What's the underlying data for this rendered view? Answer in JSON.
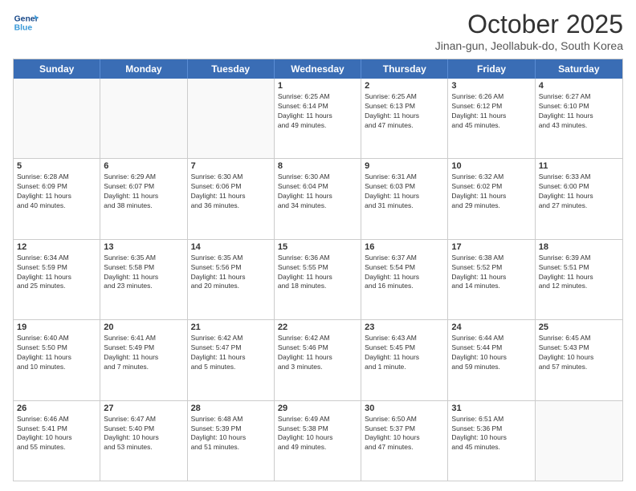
{
  "logo": {
    "line1": "General",
    "line2": "Blue"
  },
  "title": "October 2025",
  "subtitle": "Jinan-gun, Jeollabuk-do, South Korea",
  "days_of_week": [
    "Sunday",
    "Monday",
    "Tuesday",
    "Wednesday",
    "Thursday",
    "Friday",
    "Saturday"
  ],
  "weeks": [
    [
      {
        "day": "",
        "info": ""
      },
      {
        "day": "",
        "info": ""
      },
      {
        "day": "",
        "info": ""
      },
      {
        "day": "1",
        "info": "Sunrise: 6:25 AM\nSunset: 6:14 PM\nDaylight: 11 hours\nand 49 minutes."
      },
      {
        "day": "2",
        "info": "Sunrise: 6:25 AM\nSunset: 6:13 PM\nDaylight: 11 hours\nand 47 minutes."
      },
      {
        "day": "3",
        "info": "Sunrise: 6:26 AM\nSunset: 6:12 PM\nDaylight: 11 hours\nand 45 minutes."
      },
      {
        "day": "4",
        "info": "Sunrise: 6:27 AM\nSunset: 6:10 PM\nDaylight: 11 hours\nand 43 minutes."
      }
    ],
    [
      {
        "day": "5",
        "info": "Sunrise: 6:28 AM\nSunset: 6:09 PM\nDaylight: 11 hours\nand 40 minutes."
      },
      {
        "day": "6",
        "info": "Sunrise: 6:29 AM\nSunset: 6:07 PM\nDaylight: 11 hours\nand 38 minutes."
      },
      {
        "day": "7",
        "info": "Sunrise: 6:30 AM\nSunset: 6:06 PM\nDaylight: 11 hours\nand 36 minutes."
      },
      {
        "day": "8",
        "info": "Sunrise: 6:30 AM\nSunset: 6:04 PM\nDaylight: 11 hours\nand 34 minutes."
      },
      {
        "day": "9",
        "info": "Sunrise: 6:31 AM\nSunset: 6:03 PM\nDaylight: 11 hours\nand 31 minutes."
      },
      {
        "day": "10",
        "info": "Sunrise: 6:32 AM\nSunset: 6:02 PM\nDaylight: 11 hours\nand 29 minutes."
      },
      {
        "day": "11",
        "info": "Sunrise: 6:33 AM\nSunset: 6:00 PM\nDaylight: 11 hours\nand 27 minutes."
      }
    ],
    [
      {
        "day": "12",
        "info": "Sunrise: 6:34 AM\nSunset: 5:59 PM\nDaylight: 11 hours\nand 25 minutes."
      },
      {
        "day": "13",
        "info": "Sunrise: 6:35 AM\nSunset: 5:58 PM\nDaylight: 11 hours\nand 23 minutes."
      },
      {
        "day": "14",
        "info": "Sunrise: 6:35 AM\nSunset: 5:56 PM\nDaylight: 11 hours\nand 20 minutes."
      },
      {
        "day": "15",
        "info": "Sunrise: 6:36 AM\nSunset: 5:55 PM\nDaylight: 11 hours\nand 18 minutes."
      },
      {
        "day": "16",
        "info": "Sunrise: 6:37 AM\nSunset: 5:54 PM\nDaylight: 11 hours\nand 16 minutes."
      },
      {
        "day": "17",
        "info": "Sunrise: 6:38 AM\nSunset: 5:52 PM\nDaylight: 11 hours\nand 14 minutes."
      },
      {
        "day": "18",
        "info": "Sunrise: 6:39 AM\nSunset: 5:51 PM\nDaylight: 11 hours\nand 12 minutes."
      }
    ],
    [
      {
        "day": "19",
        "info": "Sunrise: 6:40 AM\nSunset: 5:50 PM\nDaylight: 11 hours\nand 10 minutes."
      },
      {
        "day": "20",
        "info": "Sunrise: 6:41 AM\nSunset: 5:49 PM\nDaylight: 11 hours\nand 7 minutes."
      },
      {
        "day": "21",
        "info": "Sunrise: 6:42 AM\nSunset: 5:47 PM\nDaylight: 11 hours\nand 5 minutes."
      },
      {
        "day": "22",
        "info": "Sunrise: 6:42 AM\nSunset: 5:46 PM\nDaylight: 11 hours\nand 3 minutes."
      },
      {
        "day": "23",
        "info": "Sunrise: 6:43 AM\nSunset: 5:45 PM\nDaylight: 11 hours\nand 1 minute."
      },
      {
        "day": "24",
        "info": "Sunrise: 6:44 AM\nSunset: 5:44 PM\nDaylight: 10 hours\nand 59 minutes."
      },
      {
        "day": "25",
        "info": "Sunrise: 6:45 AM\nSunset: 5:43 PM\nDaylight: 10 hours\nand 57 minutes."
      }
    ],
    [
      {
        "day": "26",
        "info": "Sunrise: 6:46 AM\nSunset: 5:41 PM\nDaylight: 10 hours\nand 55 minutes."
      },
      {
        "day": "27",
        "info": "Sunrise: 6:47 AM\nSunset: 5:40 PM\nDaylight: 10 hours\nand 53 minutes."
      },
      {
        "day": "28",
        "info": "Sunrise: 6:48 AM\nSunset: 5:39 PM\nDaylight: 10 hours\nand 51 minutes."
      },
      {
        "day": "29",
        "info": "Sunrise: 6:49 AM\nSunset: 5:38 PM\nDaylight: 10 hours\nand 49 minutes."
      },
      {
        "day": "30",
        "info": "Sunrise: 6:50 AM\nSunset: 5:37 PM\nDaylight: 10 hours\nand 47 minutes."
      },
      {
        "day": "31",
        "info": "Sunrise: 6:51 AM\nSunset: 5:36 PM\nDaylight: 10 hours\nand 45 minutes."
      },
      {
        "day": "",
        "info": ""
      }
    ]
  ]
}
